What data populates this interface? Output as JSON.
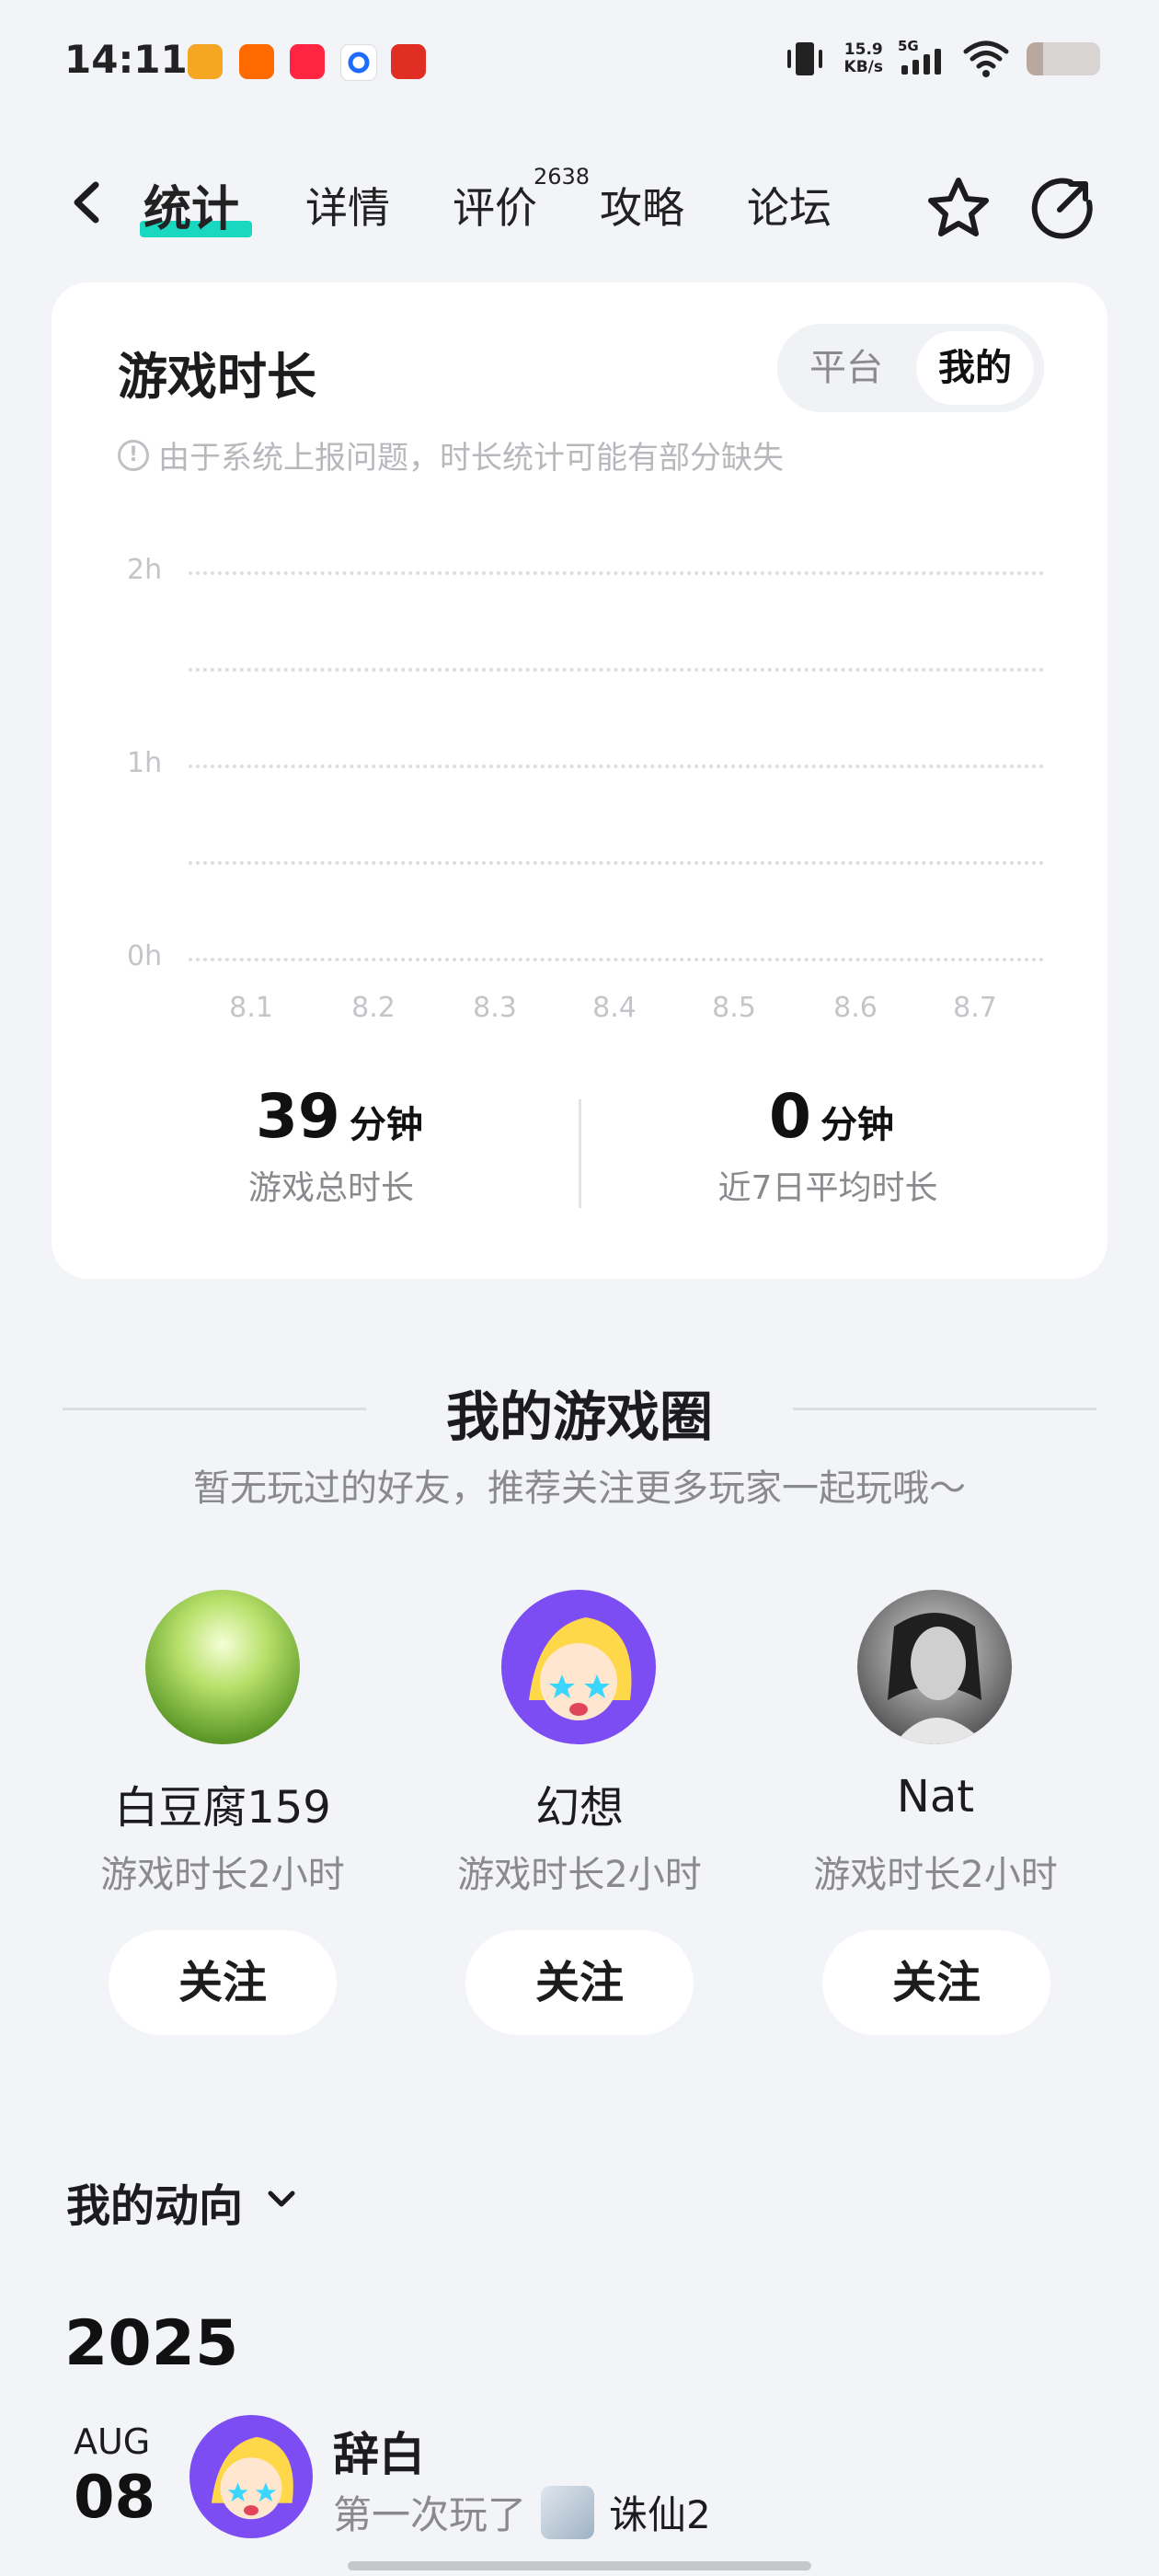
{
  "status_bar": {
    "time": "14:11",
    "net_speed": "15.9",
    "net_unit": "KB/s",
    "network": "5G"
  },
  "nav": {
    "tabs": [
      {
        "label": "统计",
        "active": true
      },
      {
        "label": "详情"
      },
      {
        "label": "评价",
        "badge": "2638"
      },
      {
        "label": "攻略"
      },
      {
        "label": "论坛"
      }
    ],
    "accent": "#1ad7c0"
  },
  "playtime": {
    "title": "游戏时长",
    "toggle": [
      "平台",
      "我的"
    ],
    "toggle_selected": "我的",
    "note": "由于系统上报问题，时长统计可能有部分缺失"
  },
  "chart_data": {
    "type": "bar",
    "categories": [
      "8.1",
      "8.2",
      "8.3",
      "8.4",
      "8.5",
      "8.6",
      "8.7"
    ],
    "values": [
      0,
      0,
      0,
      0,
      0,
      0,
      0
    ],
    "y_ticks": [
      "2h",
      "1h",
      "0h"
    ],
    "ylim": [
      0,
      2
    ],
    "grid": true
  },
  "stats": {
    "total": {
      "value": "39",
      "unit": "分钟",
      "label": "游戏总时长"
    },
    "avg7": {
      "value": "0",
      "unit": "分钟",
      "label": "近7日平均时长"
    }
  },
  "circle": {
    "title": "我的游戏圈",
    "subtitle": "暂无玩过的好友，推荐关注更多玩家一起玩哦～",
    "players": [
      {
        "name": "白豆腐159",
        "playtime": "游戏时长2小时",
        "follow": "关注"
      },
      {
        "name": "幻想",
        "playtime": "游戏时长2小时",
        "follow": "关注"
      },
      {
        "name": "Nat",
        "playtime": "游戏时长2小时",
        "follow": "关注"
      }
    ]
  },
  "activity": {
    "title": "我的动向",
    "year": "2025",
    "entry": {
      "month": "AUG",
      "day": "08",
      "user": "辞白",
      "action": "第一次玩了",
      "game": "诛仙2"
    }
  }
}
